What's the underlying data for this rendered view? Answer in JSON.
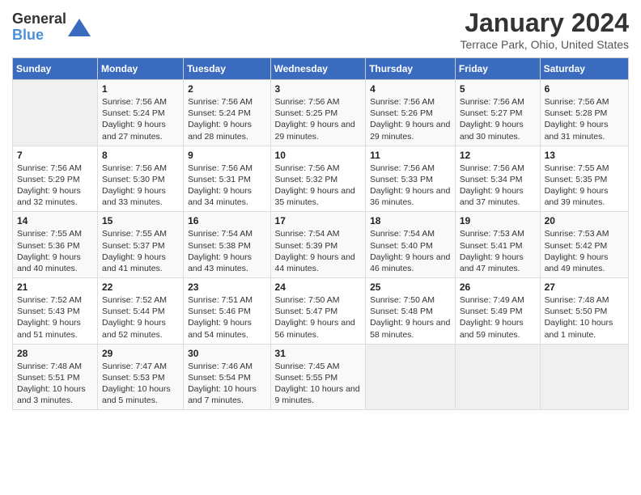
{
  "logo": {
    "text_general": "General",
    "text_blue": "Blue"
  },
  "title": "January 2024",
  "subtitle": "Terrace Park, Ohio, United States",
  "headers": [
    "Sunday",
    "Monday",
    "Tuesday",
    "Wednesday",
    "Thursday",
    "Friday",
    "Saturday"
  ],
  "weeks": [
    [
      {
        "day": "",
        "sunrise": "",
        "sunset": "",
        "daylight": ""
      },
      {
        "day": "1",
        "sunrise": "Sunrise: 7:56 AM",
        "sunset": "Sunset: 5:24 PM",
        "daylight": "Daylight: 9 hours and 27 minutes."
      },
      {
        "day": "2",
        "sunrise": "Sunrise: 7:56 AM",
        "sunset": "Sunset: 5:24 PM",
        "daylight": "Daylight: 9 hours and 28 minutes."
      },
      {
        "day": "3",
        "sunrise": "Sunrise: 7:56 AM",
        "sunset": "Sunset: 5:25 PM",
        "daylight": "Daylight: 9 hours and 29 minutes."
      },
      {
        "day": "4",
        "sunrise": "Sunrise: 7:56 AM",
        "sunset": "Sunset: 5:26 PM",
        "daylight": "Daylight: 9 hours and 29 minutes."
      },
      {
        "day": "5",
        "sunrise": "Sunrise: 7:56 AM",
        "sunset": "Sunset: 5:27 PM",
        "daylight": "Daylight: 9 hours and 30 minutes."
      },
      {
        "day": "6",
        "sunrise": "Sunrise: 7:56 AM",
        "sunset": "Sunset: 5:28 PM",
        "daylight": "Daylight: 9 hours and 31 minutes."
      }
    ],
    [
      {
        "day": "7",
        "sunrise": "Sunrise: 7:56 AM",
        "sunset": "Sunset: 5:29 PM",
        "daylight": "Daylight: 9 hours and 32 minutes."
      },
      {
        "day": "8",
        "sunrise": "Sunrise: 7:56 AM",
        "sunset": "Sunset: 5:30 PM",
        "daylight": "Daylight: 9 hours and 33 minutes."
      },
      {
        "day": "9",
        "sunrise": "Sunrise: 7:56 AM",
        "sunset": "Sunset: 5:31 PM",
        "daylight": "Daylight: 9 hours and 34 minutes."
      },
      {
        "day": "10",
        "sunrise": "Sunrise: 7:56 AM",
        "sunset": "Sunset: 5:32 PM",
        "daylight": "Daylight: 9 hours and 35 minutes."
      },
      {
        "day": "11",
        "sunrise": "Sunrise: 7:56 AM",
        "sunset": "Sunset: 5:33 PM",
        "daylight": "Daylight: 9 hours and 36 minutes."
      },
      {
        "day": "12",
        "sunrise": "Sunrise: 7:56 AM",
        "sunset": "Sunset: 5:34 PM",
        "daylight": "Daylight: 9 hours and 37 minutes."
      },
      {
        "day": "13",
        "sunrise": "Sunrise: 7:55 AM",
        "sunset": "Sunset: 5:35 PM",
        "daylight": "Daylight: 9 hours and 39 minutes."
      }
    ],
    [
      {
        "day": "14",
        "sunrise": "Sunrise: 7:55 AM",
        "sunset": "Sunset: 5:36 PM",
        "daylight": "Daylight: 9 hours and 40 minutes."
      },
      {
        "day": "15",
        "sunrise": "Sunrise: 7:55 AM",
        "sunset": "Sunset: 5:37 PM",
        "daylight": "Daylight: 9 hours and 41 minutes."
      },
      {
        "day": "16",
        "sunrise": "Sunrise: 7:54 AM",
        "sunset": "Sunset: 5:38 PM",
        "daylight": "Daylight: 9 hours and 43 minutes."
      },
      {
        "day": "17",
        "sunrise": "Sunrise: 7:54 AM",
        "sunset": "Sunset: 5:39 PM",
        "daylight": "Daylight: 9 hours and 44 minutes."
      },
      {
        "day": "18",
        "sunrise": "Sunrise: 7:54 AM",
        "sunset": "Sunset: 5:40 PM",
        "daylight": "Daylight: 9 hours and 46 minutes."
      },
      {
        "day": "19",
        "sunrise": "Sunrise: 7:53 AM",
        "sunset": "Sunset: 5:41 PM",
        "daylight": "Daylight: 9 hours and 47 minutes."
      },
      {
        "day": "20",
        "sunrise": "Sunrise: 7:53 AM",
        "sunset": "Sunset: 5:42 PM",
        "daylight": "Daylight: 9 hours and 49 minutes."
      }
    ],
    [
      {
        "day": "21",
        "sunrise": "Sunrise: 7:52 AM",
        "sunset": "Sunset: 5:43 PM",
        "daylight": "Daylight: 9 hours and 51 minutes."
      },
      {
        "day": "22",
        "sunrise": "Sunrise: 7:52 AM",
        "sunset": "Sunset: 5:44 PM",
        "daylight": "Daylight: 9 hours and 52 minutes."
      },
      {
        "day": "23",
        "sunrise": "Sunrise: 7:51 AM",
        "sunset": "Sunset: 5:46 PM",
        "daylight": "Daylight: 9 hours and 54 minutes."
      },
      {
        "day": "24",
        "sunrise": "Sunrise: 7:50 AM",
        "sunset": "Sunset: 5:47 PM",
        "daylight": "Daylight: 9 hours and 56 minutes."
      },
      {
        "day": "25",
        "sunrise": "Sunrise: 7:50 AM",
        "sunset": "Sunset: 5:48 PM",
        "daylight": "Daylight: 9 hours and 58 minutes."
      },
      {
        "day": "26",
        "sunrise": "Sunrise: 7:49 AM",
        "sunset": "Sunset: 5:49 PM",
        "daylight": "Daylight: 9 hours and 59 minutes."
      },
      {
        "day": "27",
        "sunrise": "Sunrise: 7:48 AM",
        "sunset": "Sunset: 5:50 PM",
        "daylight": "Daylight: 10 hours and 1 minute."
      }
    ],
    [
      {
        "day": "28",
        "sunrise": "Sunrise: 7:48 AM",
        "sunset": "Sunset: 5:51 PM",
        "daylight": "Daylight: 10 hours and 3 minutes."
      },
      {
        "day": "29",
        "sunrise": "Sunrise: 7:47 AM",
        "sunset": "Sunset: 5:53 PM",
        "daylight": "Daylight: 10 hours and 5 minutes."
      },
      {
        "day": "30",
        "sunrise": "Sunrise: 7:46 AM",
        "sunset": "Sunset: 5:54 PM",
        "daylight": "Daylight: 10 hours and 7 minutes."
      },
      {
        "day": "31",
        "sunrise": "Sunrise: 7:45 AM",
        "sunset": "Sunset: 5:55 PM",
        "daylight": "Daylight: 10 hours and 9 minutes."
      },
      {
        "day": "",
        "sunrise": "",
        "sunset": "",
        "daylight": ""
      },
      {
        "day": "",
        "sunrise": "",
        "sunset": "",
        "daylight": ""
      },
      {
        "day": "",
        "sunrise": "",
        "sunset": "",
        "daylight": ""
      }
    ]
  ]
}
